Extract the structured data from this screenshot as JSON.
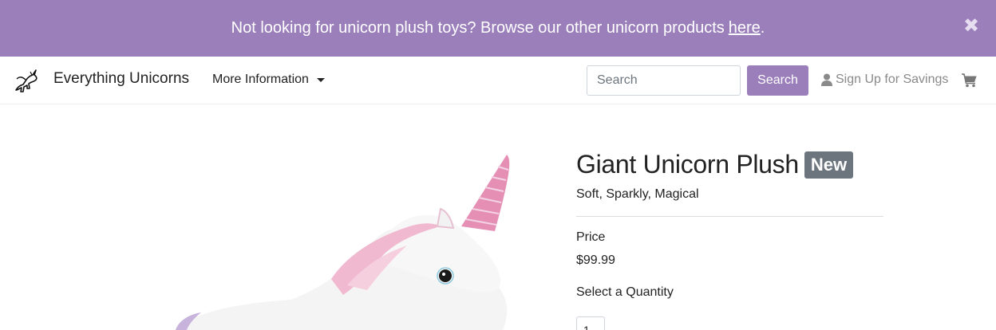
{
  "banner": {
    "message": "Not looking for unicorn plush toys? Browse our other unicorn products",
    "link_text": "here",
    "period": ".",
    "close_symbol": "✖",
    "background": "#9b7fbb"
  },
  "navbar": {
    "brand": "Everything Unicorns",
    "dropdown_label": "More Information",
    "search_placeholder": "Search",
    "search_button": "Search",
    "signup_label": "Sign Up for Savings",
    "icons": [
      "unicorn-logo-icon",
      "chevron-down-icon",
      "user-icon",
      "cart-icon"
    ]
  },
  "product": {
    "title": "Giant Unicorn Plush",
    "badge": "New",
    "subtitle": "Soft, Sparkly, Magical",
    "price_label": "Price",
    "price": "$99.99",
    "quantity_label": "Select a Quantity",
    "quantity_value": "1"
  },
  "colors": {
    "accent": "#9b7fbb",
    "badge": "#6c757d",
    "horn": "#e58fb4",
    "plush": "#f6f6f6",
    "mane": "#f3b8d0"
  }
}
